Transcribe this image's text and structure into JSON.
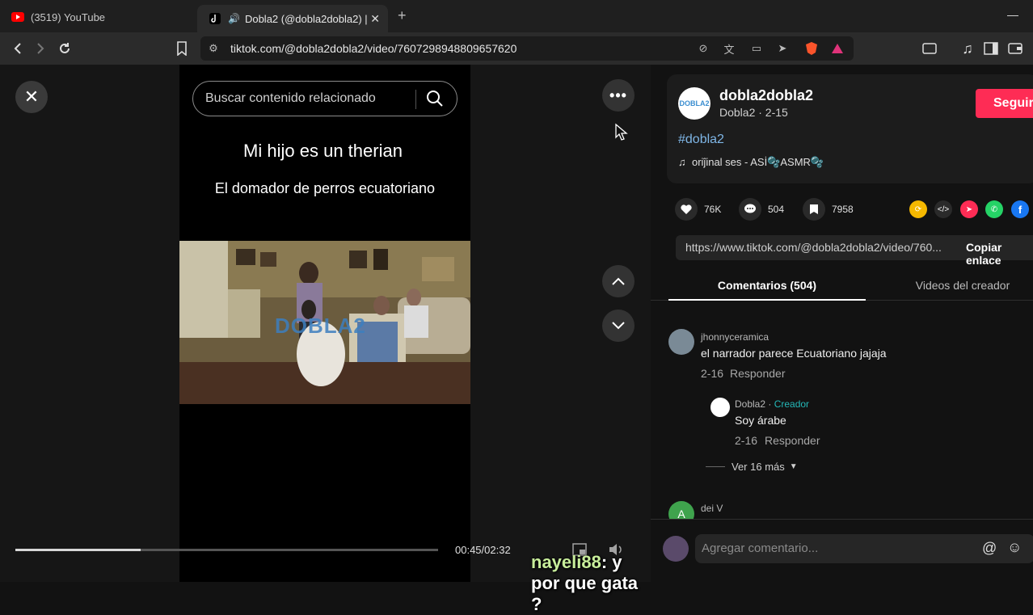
{
  "browser": {
    "tabs": [
      {
        "title": "(3519) YouTube",
        "active": false
      },
      {
        "title": "Dobla2 (@dobla2dobla2) |",
        "active": true
      }
    ],
    "url": "tiktok.com/@dobla2dobla2/video/7607298948809657620"
  },
  "player": {
    "search_placeholder": "Buscar contenido relacionado",
    "video_title": "Mi hijo es un therian",
    "video_subtitle": "El domador de perros ecuatoriano",
    "watermark": "DOBLA2",
    "time": "00:45/02:32",
    "progress_fraction": 0.296
  },
  "stream_overlay": {
    "user": "nayeli88",
    "message": ": y por que gata ?"
  },
  "creator": {
    "avatar_text": "DOBLA2",
    "username": "dobla2dobla2",
    "subline": "Dobla2 · 2-15",
    "follow_label": "Seguir",
    "hashtag": "#dobla2",
    "music": "oriĵinal ses - ASİ🫧ASMR🫧"
  },
  "stats": {
    "likes": "76K",
    "comments": "504",
    "saves": "7958"
  },
  "share_link": {
    "url": "https://www.tiktok.com/@dobla2dobla2/video/760...",
    "copy_label": "Copiar enlace"
  },
  "tabs": {
    "comments": "Comentarios (504)",
    "creator_videos": "Videos del creador"
  },
  "comments": [
    {
      "user": "jhonnyceramica",
      "text": "el narrador parece Ecuatoriano jajaja",
      "date": "2-16",
      "reply": "Responder"
    },
    {
      "user": "Dobla2",
      "badge": "Creador",
      "text": "Soy árabe",
      "date": "2-16",
      "reply": "Responder"
    },
    {
      "more": "Ver 16 más"
    },
    {
      "user": "dei V",
      "avatar_letter": "A"
    }
  ],
  "composer": {
    "placeholder": "Agregar comentario..."
  },
  "colors": {
    "accent": "#fe2c55",
    "hashtag": "#7fb6e6",
    "creator_badge": "#24b8b8"
  }
}
